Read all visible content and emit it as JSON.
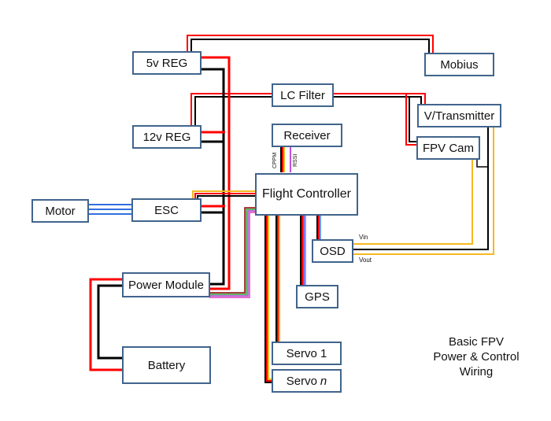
{
  "diagram": {
    "title_lines": [
      "Basic FPV",
      "Power & Control",
      "Wiring"
    ],
    "components": {
      "reg5v": "5v REG",
      "mobius": "Mobius",
      "lc_filter": "LC Filter",
      "reg12v": "12v REG",
      "receiver": "Receiver",
      "vtx": "V/Transmitter",
      "fpv_cam": "FPV Cam",
      "motor": "Motor",
      "esc": "ESC",
      "flight_controller": "Flight Controller",
      "osd": "OSD",
      "power_module": "Power Module",
      "gps": "GPS",
      "battery": "Battery",
      "servo1": "Servo 1",
      "servon_prefix": "Servo",
      "servon_suffix": "n"
    },
    "wire_labels": {
      "cppm": "CPPM",
      "rssi": "RSSI",
      "vin": "Vin",
      "vout": "Vout"
    },
    "colors": {
      "positive": "#ff0000",
      "ground": "#000000",
      "signal": "#f5b820",
      "motor_phase": "#2f6fe0",
      "rssi": "#c050e0",
      "gps_blue": "#3a78ff",
      "box_border": "#41648c"
    }
  }
}
